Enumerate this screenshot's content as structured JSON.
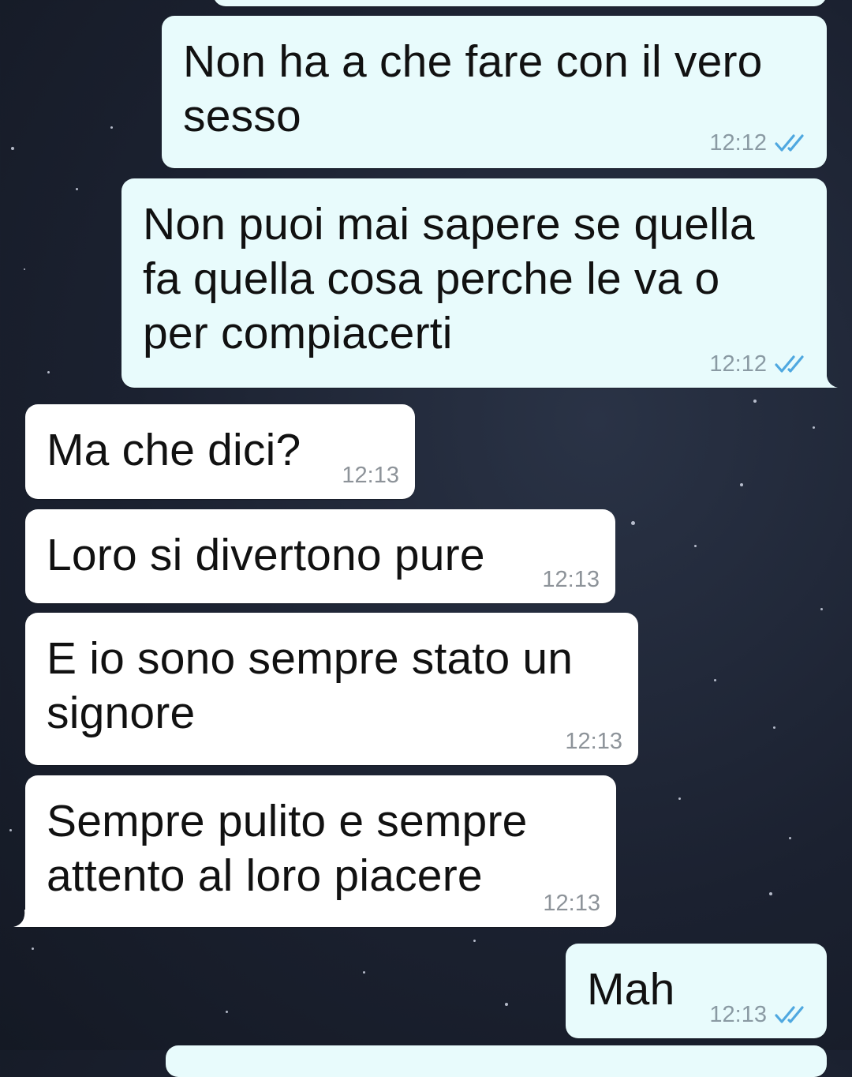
{
  "chat": {
    "messages": [
      {
        "direction": "outgoing",
        "text": "Non ha a che fare con il vero\nsesso",
        "time": "12:12",
        "status": "read-double-check"
      },
      {
        "direction": "outgoing",
        "text": "Non puoi mai sapere se quella\nfa quella cosa perche le va o\nper compiacerti",
        "time": "12:12",
        "status": "read-double-check"
      },
      {
        "direction": "incoming",
        "text": "Ma che dici?",
        "time": "12:13"
      },
      {
        "direction": "incoming",
        "text": "Loro si divertono pure",
        "time": "12:13"
      },
      {
        "direction": "incoming",
        "text": "E io sono sempre stato un\nsignore",
        "time": "12:13"
      },
      {
        "direction": "incoming",
        "text": "Sempre pulito e sempre\nattento al loro piacere",
        "time": "12:13"
      },
      {
        "direction": "outgoing",
        "text": "Mah",
        "time": "12:13",
        "status": "read-double-check"
      }
    ]
  },
  "colors": {
    "outgoing_bubble": "#e8fbfc",
    "incoming_bubble": "#ffffff",
    "read_check": "#4fa8e0",
    "background": "#1b2130"
  },
  "icons": {
    "read_status": "double-check-icon"
  }
}
